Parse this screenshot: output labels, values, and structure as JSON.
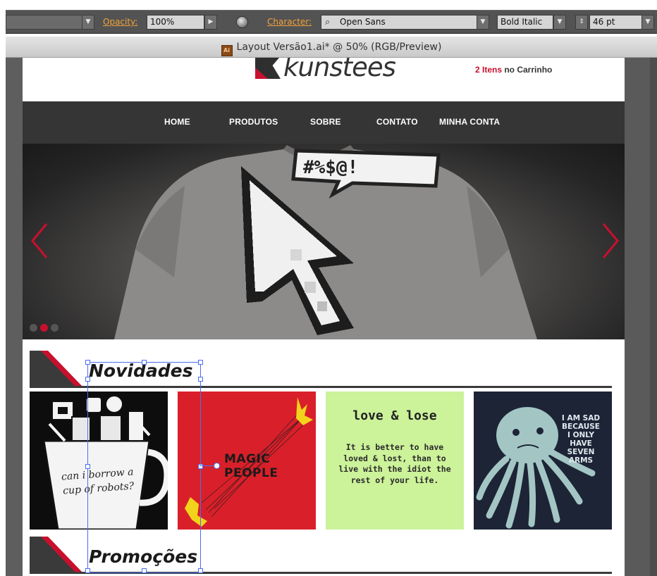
{
  "control_bar": {
    "opacity_label": "Opacity:",
    "opacity_value": "100%",
    "character_label": "Character:",
    "font_family": "Open Sans",
    "font_style": "Bold Italic",
    "font_size": "46 pt",
    "dropdown_glyph": "▼",
    "next_glyph": "▶",
    "stepper_glyph": "⇕",
    "search_glyph": "⌕"
  },
  "document": {
    "title": "Layout Versão1.ai* @ 50% (RGB/Preview)",
    "icon_text": "Ai"
  },
  "site": {
    "logo_text": "kunstees",
    "cart": {
      "count": "2 Itens",
      "suffix": " no Carrinho"
    },
    "nav": [
      "HOME",
      "PRODUTOS",
      "SOBRE",
      "CONTATO",
      "MINHA CONTA"
    ],
    "hero": {
      "speech_text": "#%$@!",
      "dots": 3,
      "active_dot": 1
    },
    "sections": [
      {
        "title": "Novidades"
      },
      {
        "title": "Promoções"
      }
    ],
    "products": [
      {
        "name": "cup-of-robots",
        "text": "can i borrow a cup of robots?"
      },
      {
        "name": "magic-people",
        "text_line1": "MAGIC",
        "text_line2": "PEOPLE"
      },
      {
        "name": "love-lose",
        "title": "love & lose",
        "body": "It is better to have loved & lost, than to live with the idiot the rest of your life."
      },
      {
        "name": "sad-octopus",
        "text": "I AM SAD BECAUSE I ONLY HAVE SEVEN ARMS"
      }
    ]
  },
  "colors": {
    "accent": "#c8102e",
    "nav_bg": "#353535",
    "control_bar": "#535353",
    "selection": "#4a6df0",
    "product_love_bg": "#ccf29a",
    "product_magic_bg": "#d9202a",
    "product_sad_bg": "#1c2436"
  }
}
